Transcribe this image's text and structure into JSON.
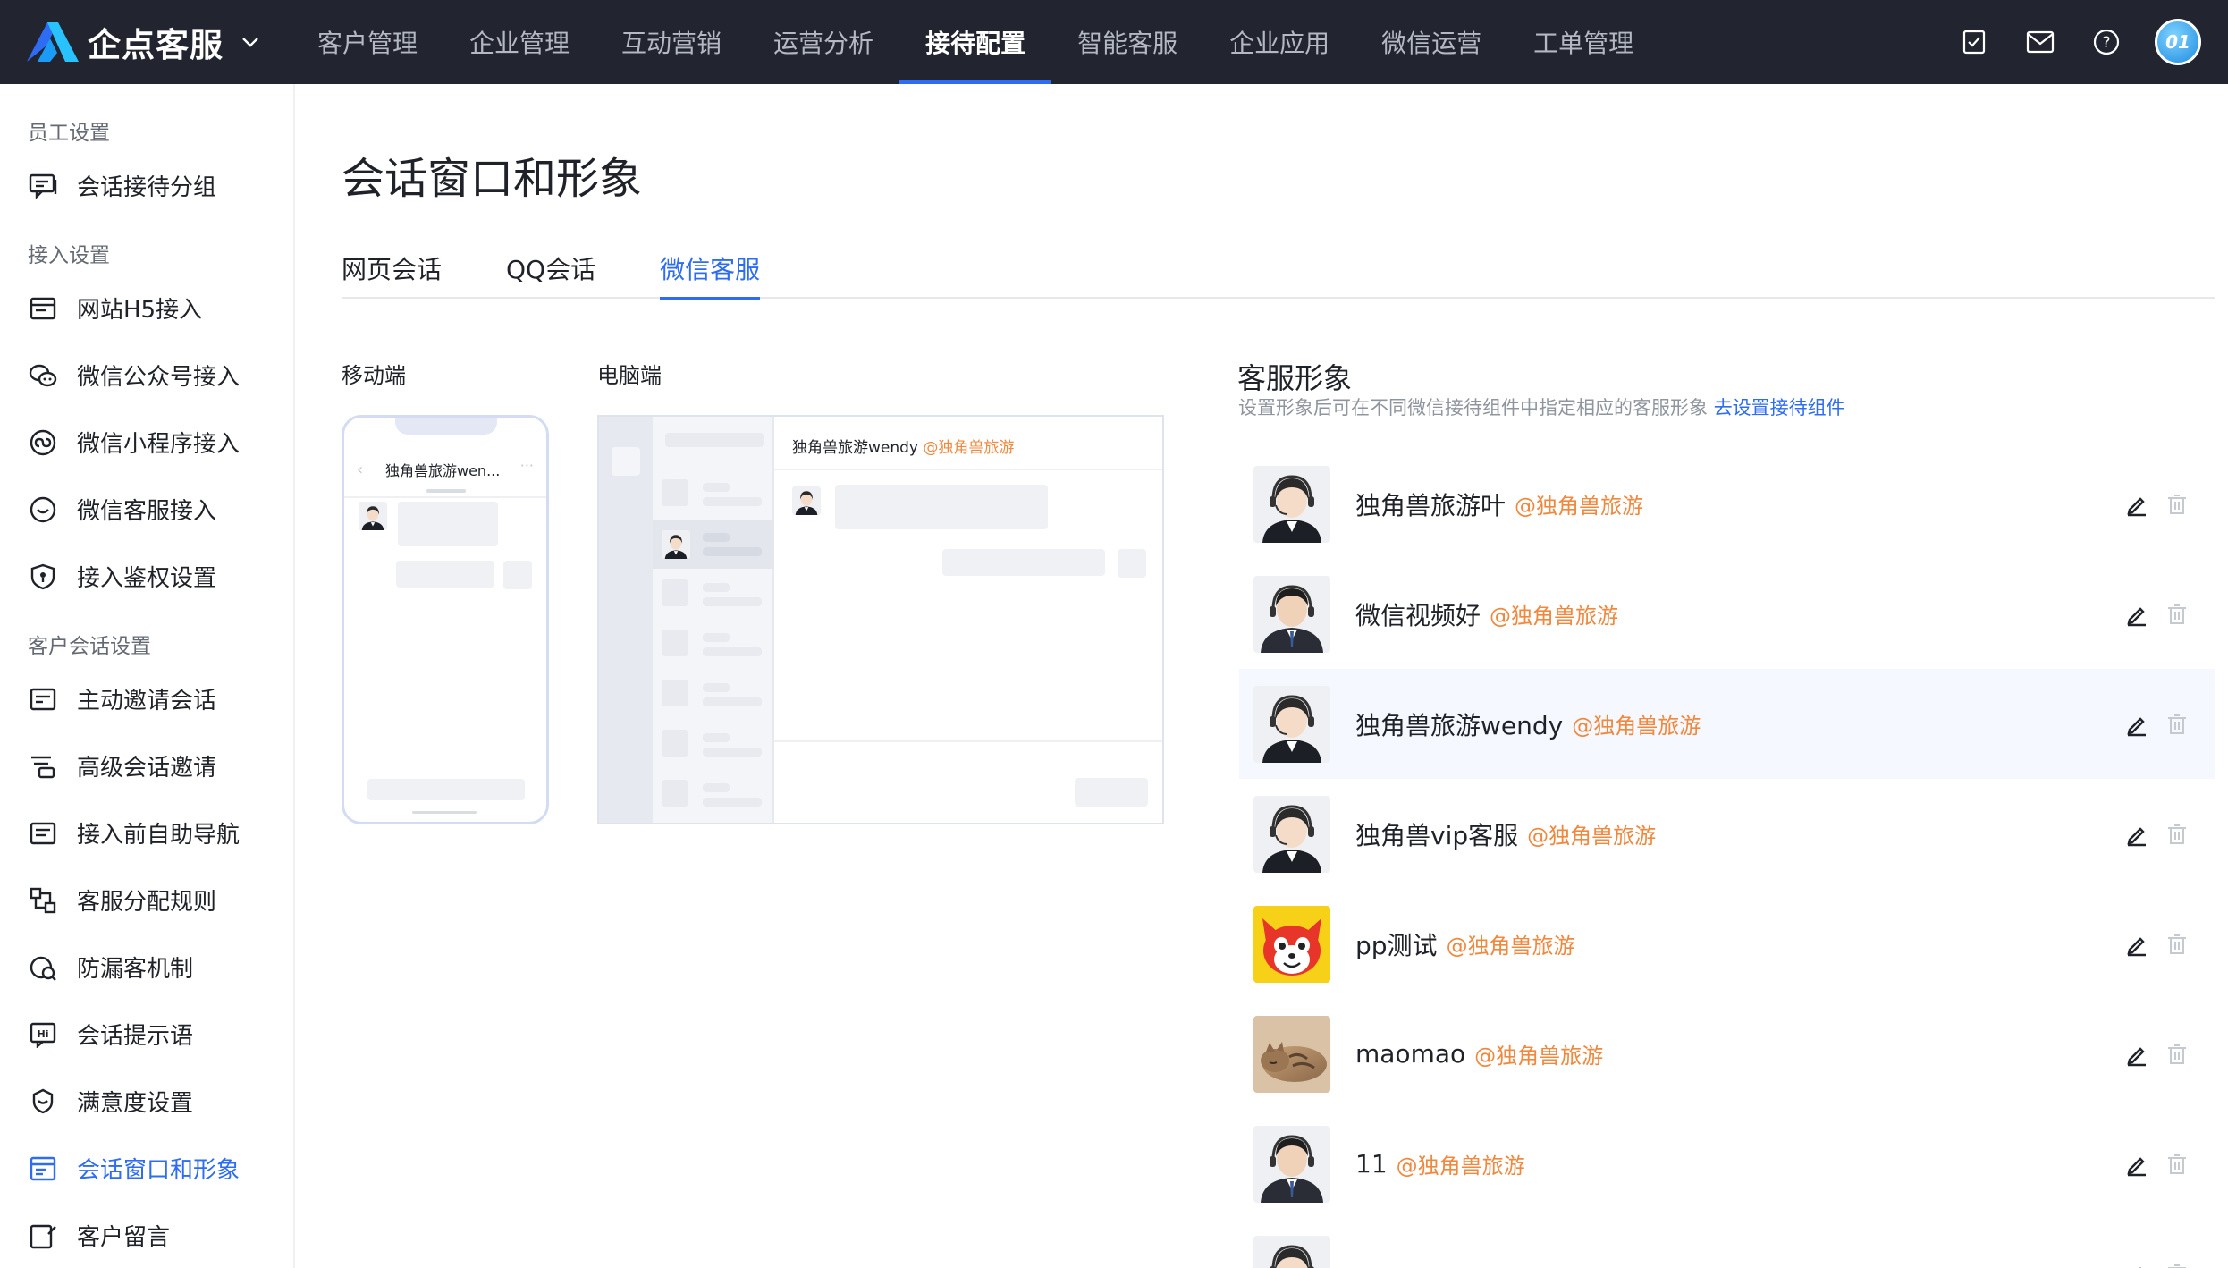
{
  "brand": {
    "name": "企点客服"
  },
  "nav": {
    "items": [
      {
        "label": "客户管理"
      },
      {
        "label": "企业管理"
      },
      {
        "label": "互动营销"
      },
      {
        "label": "运营分析"
      },
      {
        "label": "接待配置"
      },
      {
        "label": "智能客服"
      },
      {
        "label": "企业应用"
      },
      {
        "label": "微信运营"
      },
      {
        "label": "工单管理"
      }
    ],
    "active": "接待配置",
    "avatar_text": "01"
  },
  "sidebar": {
    "sections": [
      {
        "title": "员工设置",
        "items": [
          {
            "label": "会话接待分组",
            "icon": "chat-group-icon"
          }
        ]
      },
      {
        "title": "接入设置",
        "items": [
          {
            "label": "网站H5接入",
            "icon": "web-icon"
          },
          {
            "label": "微信公众号接入",
            "icon": "wechat-icon"
          },
          {
            "label": "微信小程序接入",
            "icon": "miniprogram-icon"
          },
          {
            "label": "微信客服接入",
            "icon": "wechat-service-icon"
          },
          {
            "label": "接入鉴权设置",
            "icon": "shield-icon"
          }
        ]
      },
      {
        "title": "客户会话设置",
        "items": [
          {
            "label": "主动邀请会话",
            "icon": "invite-icon"
          },
          {
            "label": "高级会话邀请",
            "icon": "advanced-invite-icon"
          },
          {
            "label": "接入前自助导航",
            "icon": "navigation-icon"
          },
          {
            "label": "客服分配规则",
            "icon": "rules-icon"
          },
          {
            "label": "防漏客机制",
            "icon": "anti-loss-icon"
          },
          {
            "label": "会话提示语",
            "icon": "hint-icon"
          },
          {
            "label": "满意度设置",
            "icon": "satisfaction-icon"
          },
          {
            "label": "会话窗口和形象",
            "icon": "window-icon"
          },
          {
            "label": "客户留言",
            "icon": "message-icon"
          }
        ]
      }
    ],
    "active": "会话窗口和形象"
  },
  "page": {
    "title": "会话窗口和形象",
    "tabs": [
      {
        "label": "网页会话"
      },
      {
        "label": "QQ会话"
      },
      {
        "label": "微信客服"
      }
    ],
    "active_tab": "微信客服"
  },
  "preview": {
    "mobile_label": "移动端",
    "desktop_label": "电脑端",
    "mobile_title": "独角兽旅游wen...",
    "desktop_title": "独角兽旅游wendy",
    "desktop_org": "@独角兽旅游"
  },
  "profiles": {
    "title": "客服形象",
    "desc": "设置形象后可在不同微信接待组件中指定相应的客服形象",
    "link": "去设置接待组件",
    "items": [
      {
        "name": "独角兽旅游叶",
        "org": "@独角兽旅游",
        "avatar": "agent-female"
      },
      {
        "name": "微信视频好",
        "org": "@独角兽旅游",
        "avatar": "agent-male"
      },
      {
        "name": "独角兽旅游wendy",
        "org": "@独角兽旅游",
        "avatar": "agent-female"
      },
      {
        "name": "独角兽vip客服",
        "org": "@独角兽旅游",
        "avatar": "agent-female"
      },
      {
        "name": "pp测试",
        "org": "@独角兽旅游",
        "avatar": "fox-cartoon"
      },
      {
        "name": "maomao",
        "org": "@独角兽旅游",
        "avatar": "cat-photo"
      },
      {
        "name": "11",
        "org": "@独角兽旅游",
        "avatar": "agent-male"
      },
      {
        "name": "",
        "org": "",
        "avatar": "agent-female"
      }
    ],
    "highlighted_index": 2
  },
  "colors": {
    "nav_bg": "#22252f",
    "accent": "#2d6cf3",
    "org_orange": "#f0883e"
  }
}
